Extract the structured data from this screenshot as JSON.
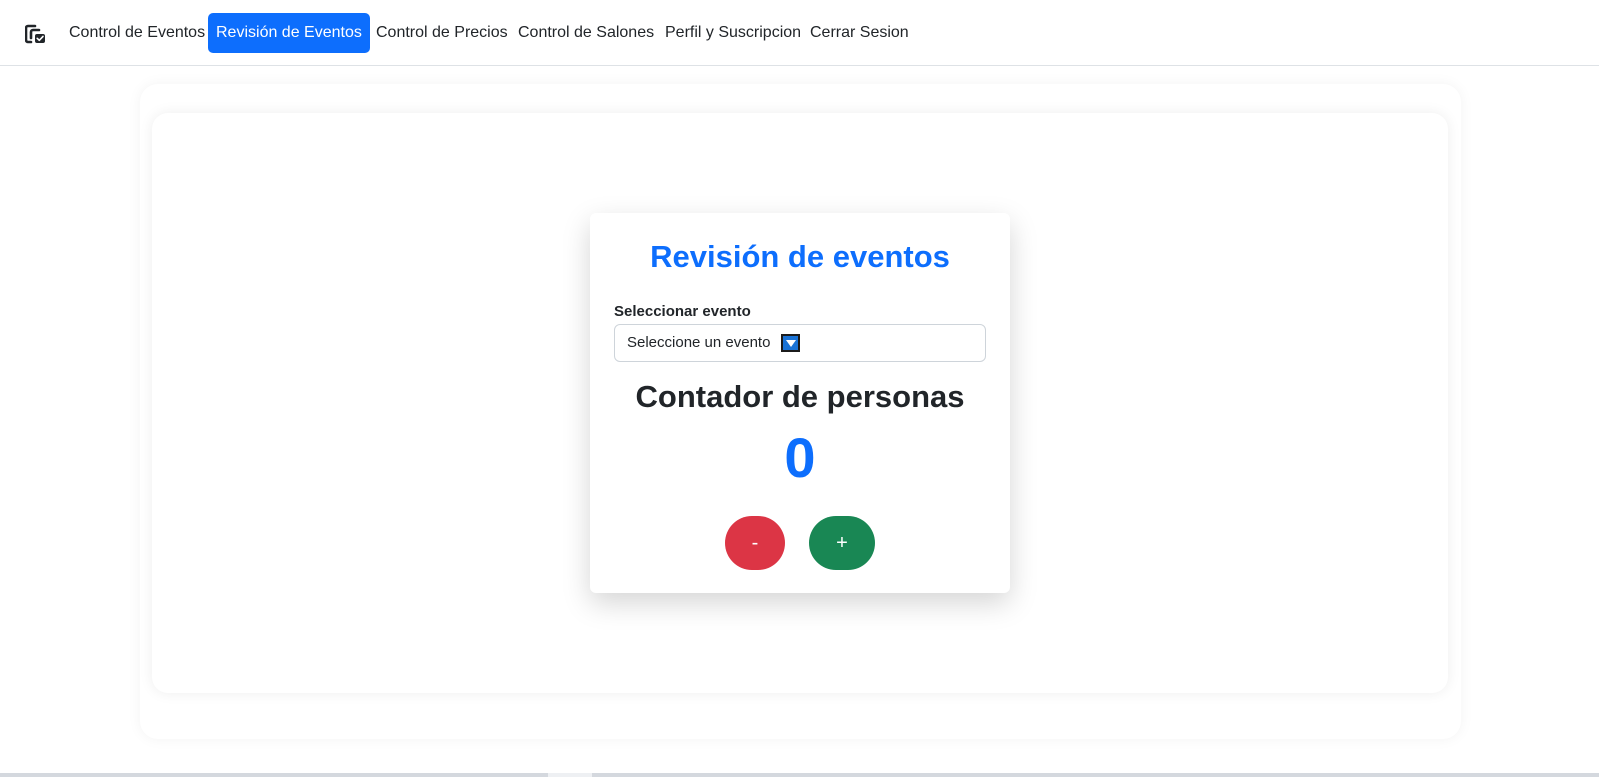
{
  "navbar": {
    "logo_icon": "logo-icon",
    "items": [
      {
        "label": "Control de Eventos",
        "active": false
      },
      {
        "label": "Revisión de Eventos",
        "active": true
      },
      {
        "label": "Control de Precios",
        "active": false
      },
      {
        "label": "Control de Salones",
        "active": false
      },
      {
        "label": "Perfil y Suscripcion",
        "active": false
      },
      {
        "label": "Cerrar Sesion",
        "active": false
      }
    ]
  },
  "card": {
    "title": "Revisión de eventos",
    "select_label": "Seleccionar evento",
    "select_value": "Seleccione un evento",
    "dropdown_icon": "dropdown-arrow-icon",
    "counter_heading": "Contador de personas",
    "counter_value": "0",
    "minus_label": "-",
    "plus_label": "+"
  },
  "colors": {
    "primary": "#0d6efd",
    "danger": "#dc3545",
    "success": "#198754",
    "text": "#212529"
  }
}
